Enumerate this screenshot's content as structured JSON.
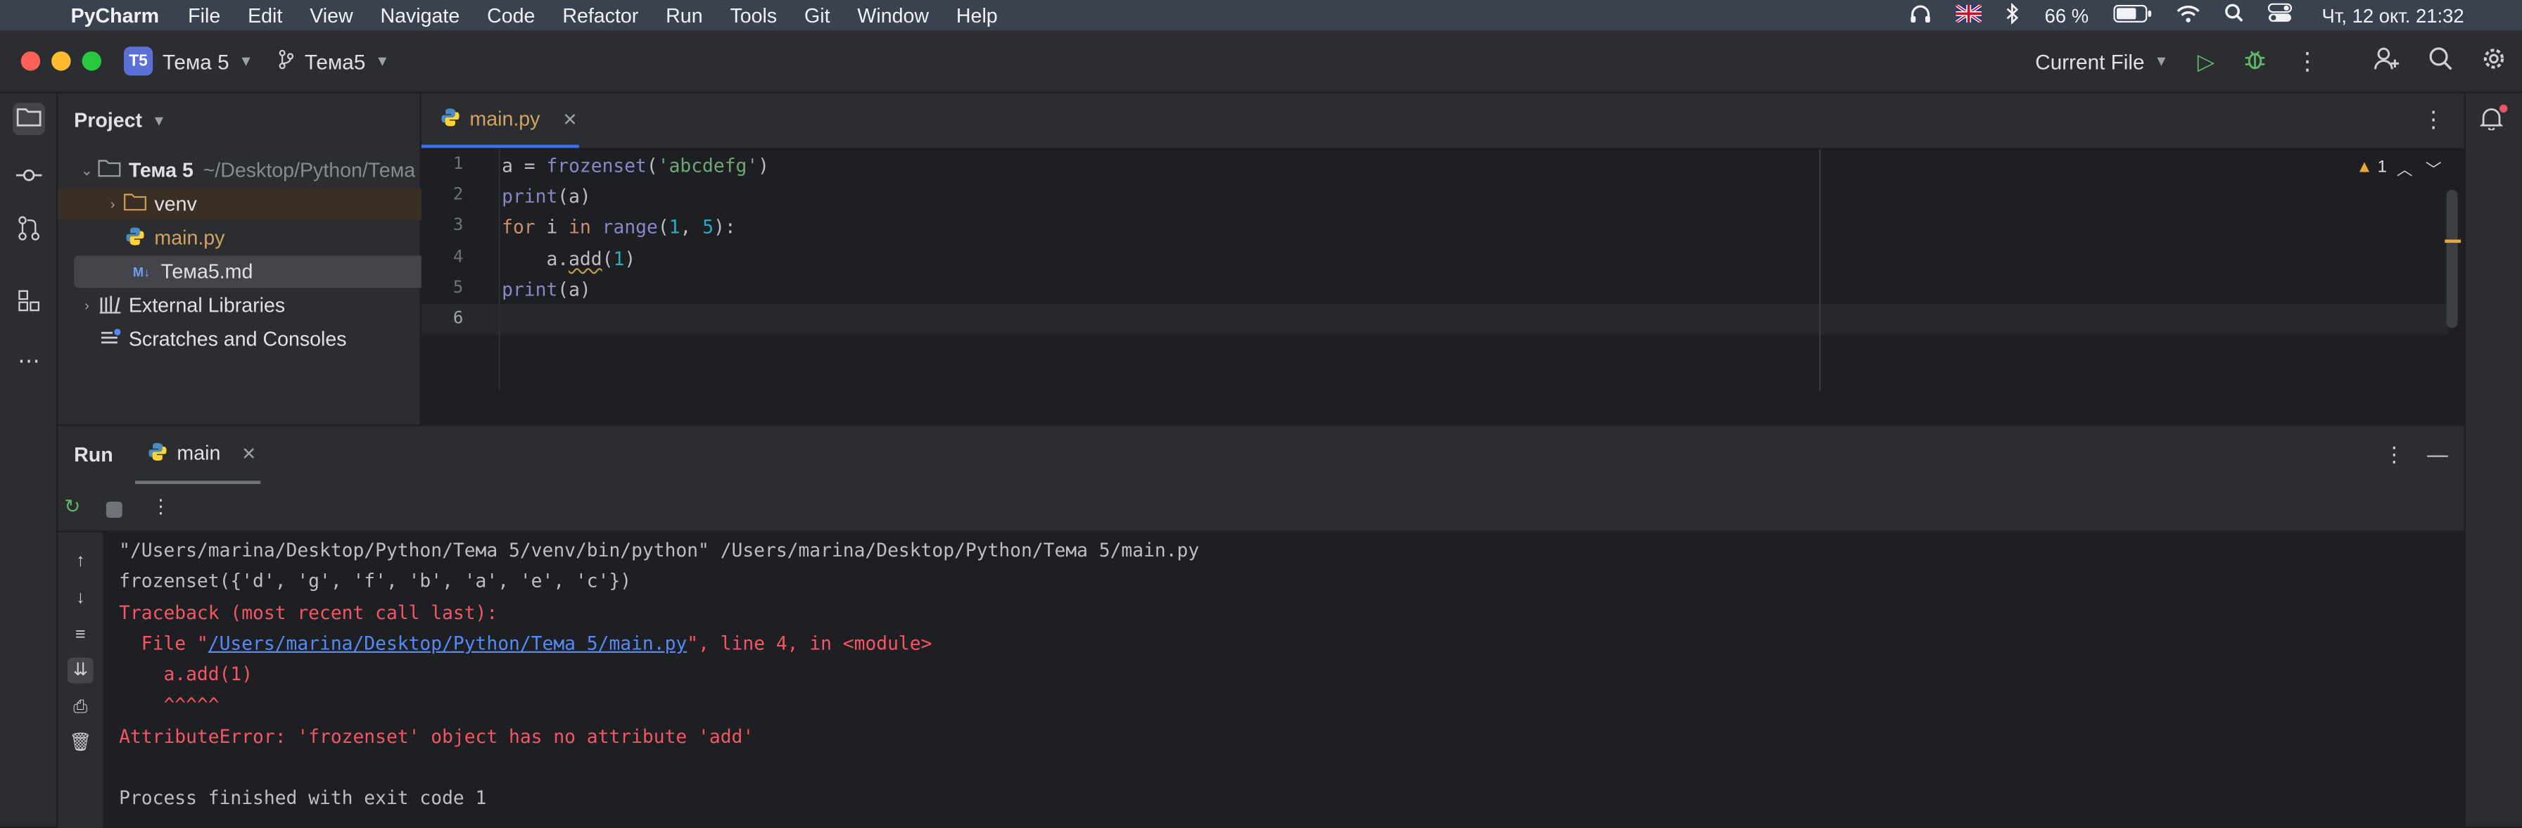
{
  "menubar": {
    "apple": "",
    "app_name": "PyCharm",
    "items": [
      "File",
      "Edit",
      "View",
      "Navigate",
      "Code",
      "Refactor",
      "Run",
      "Tools",
      "Git",
      "Window",
      "Help"
    ],
    "battery": "66 %",
    "clock": "Чт, 12 окт.  21:32"
  },
  "titlebar": {
    "project_badge": "T5",
    "project_name": "Тема 5",
    "branch": "Тема5",
    "run_config": "Current File"
  },
  "project_panel": {
    "title": "Project",
    "root_name": "Тема 5",
    "root_path": "~/Desktop/Python/Тема",
    "items": {
      "venv": "venv",
      "main": "main.py",
      "md": "Тема5.md",
      "ext_libs": "External Libraries",
      "scratches": "Scratches and Consoles"
    }
  },
  "editor": {
    "tab_label": "main.py",
    "warnings_count": "1",
    "line_numbers": [
      "1",
      "2",
      "3",
      "4",
      "5",
      "6"
    ]
  },
  "run_panel": {
    "title": "Run",
    "tab_label": "main",
    "console": {
      "cmd": "\"/Users/marina/Desktop/Python/Тема 5/venv/bin/python\" /Users/marina/Desktop/Python/Тема 5/main.py",
      "out1": "frozenset({'d', 'g', 'f', 'b', 'a', 'e', 'c'})",
      "tb_head": "Traceback (most recent call last):",
      "file_prefix": "  File \"",
      "file_link": "/Users/marina/Desktop/Python/Тема 5/main.py",
      "file_suffix": "\", line 4, in <module>",
      "err_code": "    a.add(1)",
      "carets": "    ^^^^^",
      "error": "AttributeError: 'frozenset' object has no attribute 'add'",
      "exit": "Process finished with exit code 1"
    }
  }
}
